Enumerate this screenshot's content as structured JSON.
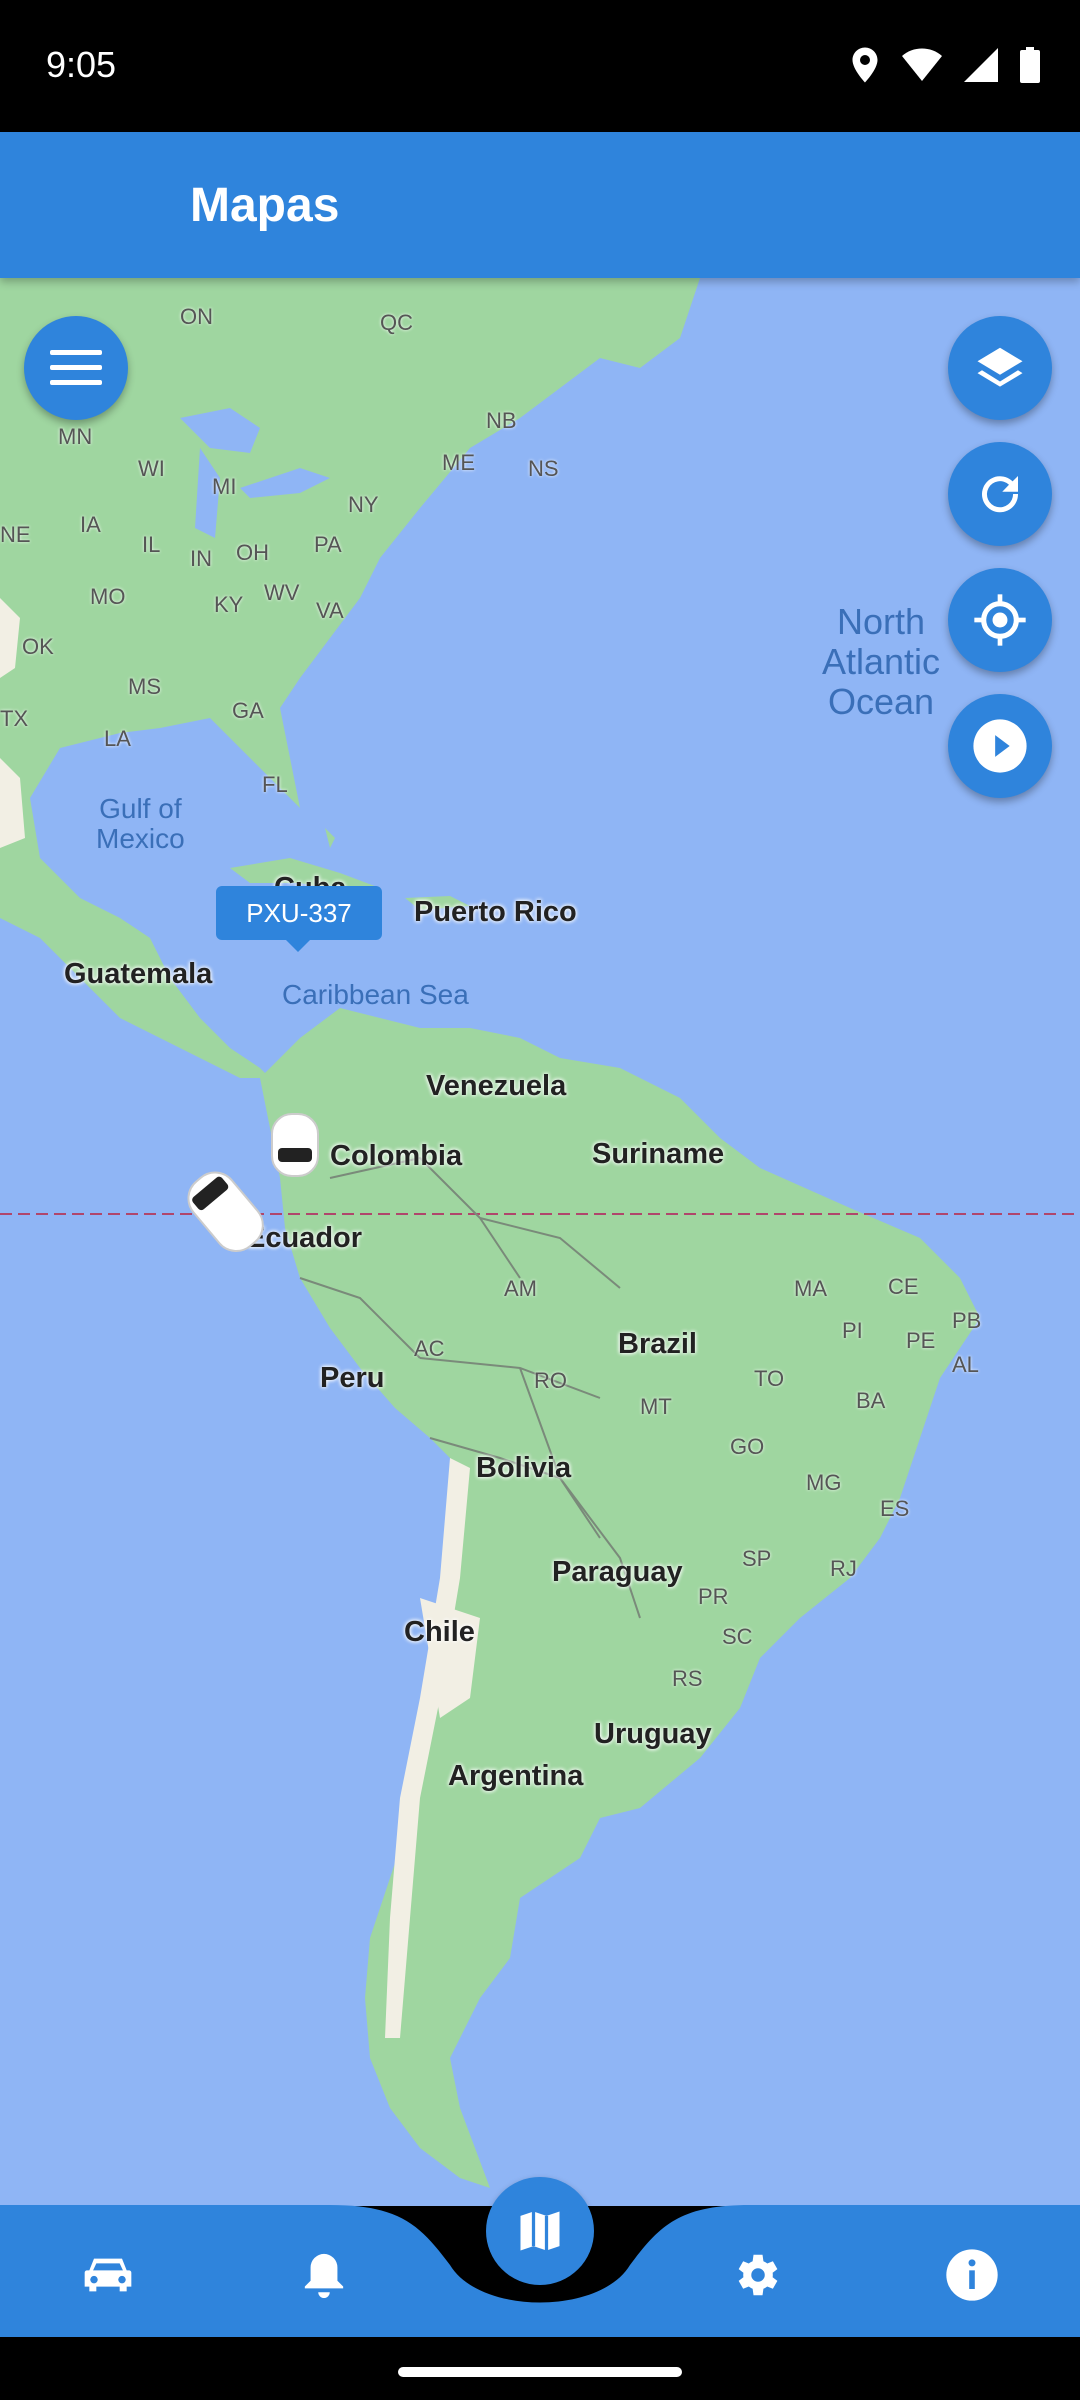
{
  "status_bar": {
    "time": "9:05",
    "icons": [
      "location-icon",
      "wifi-icon",
      "signal-icon",
      "battery-icon"
    ]
  },
  "app_bar": {
    "title": "Mapas"
  },
  "map": {
    "vehicle": {
      "plate": "PXU-337"
    },
    "labels": {
      "countries": [
        "Cuba",
        "Puerto Rico",
        "Guatemala",
        "Venezuela",
        "Colombia",
        "Suriname",
        "Ecuador",
        "Peru",
        "Brazil",
        "Bolivia",
        "Paraguay",
        "Chile",
        "Uruguay",
        "Argentina"
      ],
      "states": [
        "ON",
        "QC",
        "MN",
        "WI",
        "MI",
        "NB",
        "ME",
        "NS",
        "NY",
        "IA",
        "IL",
        "IN",
        "OH",
        "PA",
        "MO",
        "KY",
        "WV",
        "VA",
        "OK",
        "MS",
        "GA",
        "TX",
        "LA",
        "FL",
        "AM",
        "MA",
        "CE",
        "PI",
        "PE",
        "PB",
        "AL",
        "AC",
        "RO",
        "MT",
        "TO",
        "BA",
        "GO",
        "MG",
        "ES",
        "SP",
        "RJ",
        "PR",
        "SC",
        "RS",
        "NE"
      ],
      "water": {
        "gulf_line1": "Gulf of",
        "gulf_line2": "Mexico",
        "caribbean": "Caribbean Sea",
        "ocean_line1": "North",
        "ocean_line2": "Atlantic",
        "ocean_line3": "Ocean"
      }
    }
  },
  "fabs": [
    "menu-icon",
    "layers-icon",
    "refresh-icon",
    "my-location-icon",
    "play-icon"
  ],
  "bottom_nav": [
    "car-icon",
    "bell-icon",
    "map-icon",
    "gear-icon",
    "info-icon"
  ],
  "colors": {
    "accent": "#2f84dc",
    "ocean": "#8fb5f5",
    "land": "#9fd6a0",
    "desert": "#f2efe4"
  }
}
